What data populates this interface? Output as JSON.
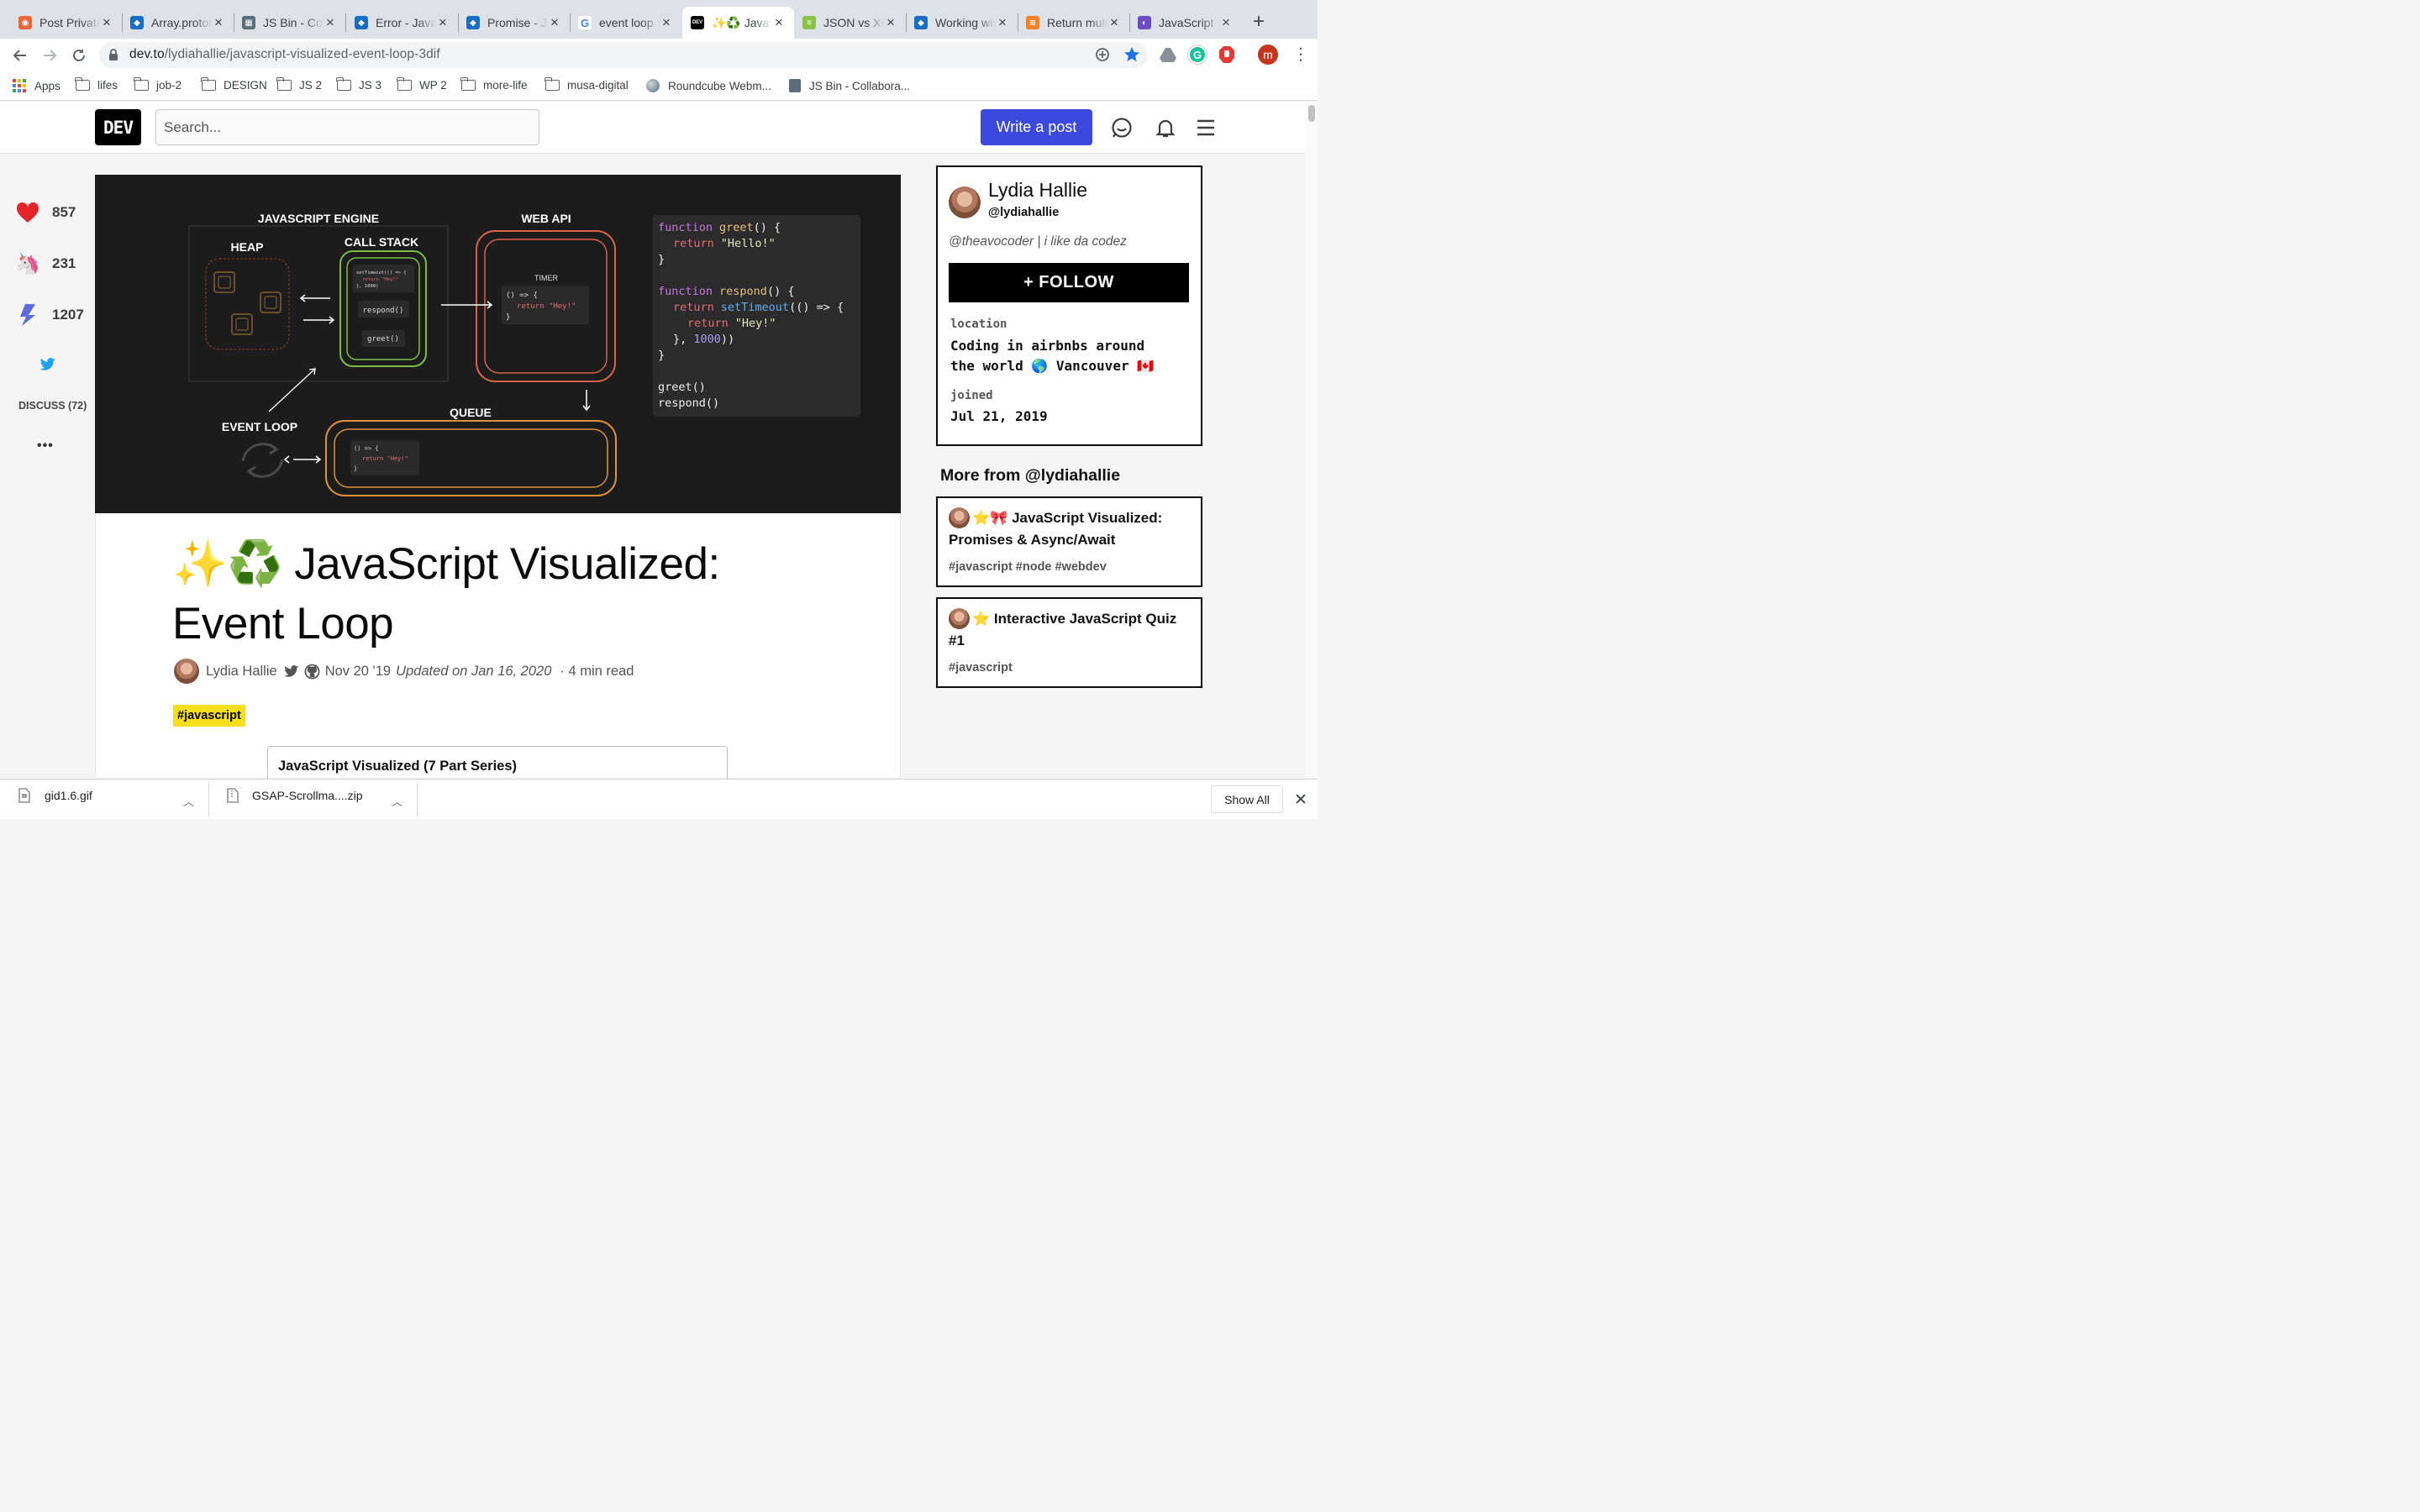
{
  "browser": {
    "tabs": [
      {
        "title": "Post Private",
        "fav_color": "#e8663c",
        "fav_glyph": "◉"
      },
      {
        "title": "Array.prototype",
        "fav_color": "#1a6dc7",
        "fav_glyph": "◆"
      },
      {
        "title": "JS Bin - Collaborative",
        "fav_color": "#5b6c7a",
        "fav_glyph": "▦"
      },
      {
        "title": "Error - JavaScript",
        "fav_color": "#1a6dc7",
        "fav_glyph": "◆"
      },
      {
        "title": "Promise - JavaScript",
        "fav_color": "#1a6dc7",
        "fav_glyph": "◆"
      },
      {
        "title": "event loop",
        "fav_color": "#ffffff",
        "fav_glyph": "G"
      },
      {
        "title": "✨♻️ JavaScript",
        "fav_color": "#000000",
        "fav_glyph": "DEV"
      },
      {
        "title": "JSON vs XML",
        "fav_color": "#8bc34a",
        "fav_glyph": "≡"
      },
      {
        "title": "Working with",
        "fav_color": "#1a6dc7",
        "fav_glyph": "◆"
      },
      {
        "title": "Return multiple",
        "fav_color": "#f48024",
        "fav_glyph": "≋"
      },
      {
        "title": "JavaScript",
        "fav_color": "#6a4cc7",
        "fav_glyph": "◐"
      }
    ],
    "active_tab_index": 6,
    "url_host": "dev.to",
    "url_path": "/lydiahallie/javascript-visualized-event-loop-3dif",
    "profile_initial": "m",
    "bookmarks": [
      {
        "label": "Apps",
        "icon": "apps-icon"
      },
      {
        "label": "lifes",
        "icon": "folder-icon"
      },
      {
        "label": "job-2",
        "icon": "folder-icon"
      },
      {
        "label": "DESIGN",
        "icon": "folder-icon"
      },
      {
        "label": "JS 2",
        "icon": "folder-icon"
      },
      {
        "label": "JS 3",
        "icon": "folder-icon"
      },
      {
        "label": "WP 2",
        "icon": "folder-icon"
      },
      {
        "label": "more-life",
        "icon": "folder-icon"
      },
      {
        "label": "musa-digital",
        "icon": "folder-icon"
      },
      {
        "label": "Roundcube Webm...",
        "icon": "roundcube-icon"
      },
      {
        "label": "JS Bin - Collabora...",
        "icon": "jsbin-icon"
      }
    ]
  },
  "dev_header": {
    "logo": "DEV",
    "search_placeholder": "Search...",
    "write_post": "Write a post"
  },
  "reactions": {
    "hearts": "857",
    "unicorns": "231",
    "bookmarks": "1207",
    "discuss": "DISCUSS (72)",
    "more": "•••"
  },
  "cover": {
    "engine_label": "JAVASCRIPT ENGINE",
    "heap_label": "HEAP",
    "callstack_label": "CALL STACK",
    "webapi_label": "WEB API",
    "timer_label": "TIMER",
    "queue_label": "QUEUE",
    "eventloop_label": "EVENT LOOP",
    "stack_frame_top_1": "setTimeout(() => {",
    "stack_frame_top_2": "return \"Hey!\"",
    "stack_frame_top_3": "}, 1000)",
    "stack_frame_mid": "respond()",
    "stack_frame_bottom": "greet()",
    "timer_code_1": "() => {",
    "timer_code_2": "return \"Hey!\"",
    "timer_code_3": "}",
    "queue_code_1": "() => {",
    "queue_code_2": "return \"Hey!\"",
    "queue_code_3": "}",
    "code": {
      "l1_kw": "function",
      "l1_fn": "greet",
      "l1_rest": "() {",
      "l2_kw": "return",
      "l2_str": "\"Hello!\"",
      "l3": "}",
      "l5_kw": "function",
      "l5_fn": "respond",
      "l5_rest": "() {",
      "l6_kw": "return",
      "l6_fn": "setTimeout",
      "l6_rest": "(() => {",
      "l7_kw": "return",
      "l7_str": "\"Hey!\"",
      "l8_a": "}, ",
      "l8_num": "1000",
      "l8_b": "))",
      "l9": "}",
      "l11": "greet()",
      "l12": "respond()"
    }
  },
  "article": {
    "title_line1": "✨♻️ JavaScript Visualized:",
    "title_line2": "Event Loop",
    "author": "Lydia Hallie",
    "date": "Nov 20 '19",
    "updated": "Updated on Jan 16, 2020",
    "read_time": "· 4 min read",
    "tag": "#javascript",
    "series_title": "JavaScript Visualized (7 Part Series)"
  },
  "profile_card": {
    "name": "Lydia Hallie",
    "handle": "@lydiahallie",
    "bio": "@theavocoder | i like da codez",
    "follow": "+ FOLLOW",
    "location_label": "location",
    "location_line1": "Coding in airbnbs around",
    "location_line2": "the world 🌎 Vancouver 🇨🇦",
    "joined_label": "joined",
    "joined": "Jul 21, 2019"
  },
  "more_from": {
    "heading": "More from @lydiahallie",
    "posts": [
      {
        "emoji": "⭐🎀",
        "title": "JavaScript Visualized: Promises & Async/Await",
        "tags": "#javascript #node #webdev"
      },
      {
        "emoji": "⭐",
        "title": "Interactive JavaScript Quiz #1",
        "tags": "#javascript"
      }
    ]
  },
  "downloads": {
    "items": [
      "gid1.6.gif",
      "GSAP-Scrollma....zip"
    ],
    "show_all": "Show All"
  }
}
